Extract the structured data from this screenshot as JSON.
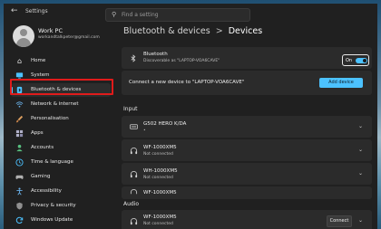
{
  "window": {
    "title": "Settings"
  },
  "search": {
    "placeholder": "Find a setting"
  },
  "user": {
    "name": "Work PC",
    "email": "workandtalkpeter@gmail.com"
  },
  "sidebar": {
    "items": [
      {
        "label": "Home",
        "icon": "home-icon",
        "color": "#e8e8e8"
      },
      {
        "label": "System",
        "icon": "monitor-icon",
        "color": "#4cc2ff"
      },
      {
        "label": "Bluetooth & devices",
        "icon": "bluetooth-icon",
        "color": "#4cc2ff",
        "selected": true
      },
      {
        "label": "Network & internet",
        "icon": "wifi-icon",
        "color": "#6ab0e8"
      },
      {
        "label": "Personalisation",
        "icon": "brush-icon",
        "color": "#e0a060"
      },
      {
        "label": "Apps",
        "icon": "apps-icon",
        "color": "#b0b0c8"
      },
      {
        "label": "Accounts",
        "icon": "person-icon",
        "color": "#58c080"
      },
      {
        "label": "Time & language",
        "icon": "clock-globe-icon",
        "color": "#4cc2ff"
      },
      {
        "label": "Gaming",
        "icon": "gamepad-icon",
        "color": "#b0b0b0"
      },
      {
        "label": "Accessibility",
        "icon": "accessibility-icon",
        "color": "#6ab0e8"
      },
      {
        "label": "Privacy & security",
        "icon": "shield-icon",
        "color": "#909090"
      },
      {
        "label": "Windows Update",
        "icon": "update-icon",
        "color": "#4cc2ff"
      }
    ]
  },
  "breadcrumb": {
    "parent": "Bluetooth & devices",
    "separator": ">",
    "current": "Devices"
  },
  "bluetooth": {
    "title": "Bluetooth",
    "subtitle": "Discoverable as \"LAPTOP-VOA6CAVE\"",
    "state_label": "On",
    "on": true
  },
  "connect": {
    "text": "Connect a new device to \"LAPTOP-VOA6CAVE\"",
    "button": "Add device"
  },
  "sections": {
    "input": "Input",
    "audio": "Audio"
  },
  "input_devices": [
    {
      "name": "G502 HERO K/DA",
      "status": "•",
      "icon": "mouse-icon"
    },
    {
      "name": "WF-1000XM5",
      "status": "Not connected",
      "icon": "headphones-icon"
    },
    {
      "name": "WH-1000XM5",
      "status": "Not connected",
      "icon": "headphones-icon"
    },
    {
      "name": "WF-1000XM5",
      "status": "Not connected",
      "icon": "headphones-icon"
    }
  ],
  "audio_devices": [
    {
      "name": "WF-1000XM5",
      "status": "Not connected",
      "icon": "headphones-icon",
      "button": "Connect"
    }
  ],
  "colors": {
    "accent": "#4cc2ff",
    "highlight": "#e01b1b",
    "background": "#202020",
    "card": "#2b2b2b"
  }
}
